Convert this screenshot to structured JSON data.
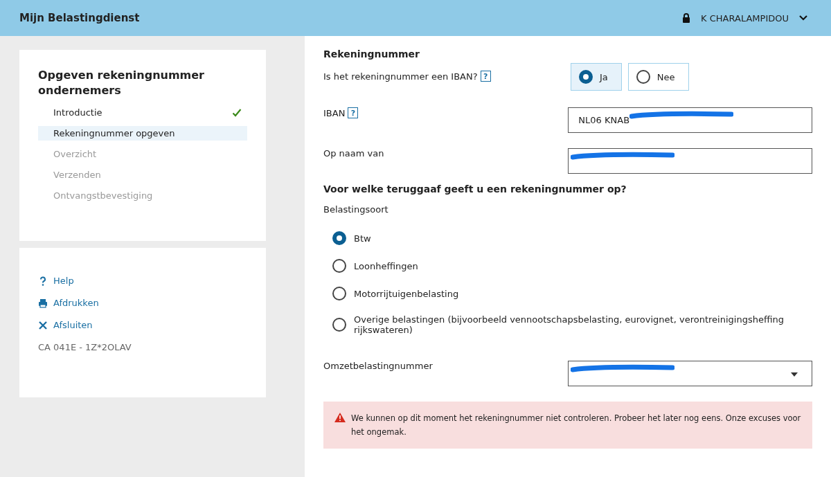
{
  "header": {
    "title": "Mijn Belastingdienst",
    "user": "K CHARALAMPIDOU"
  },
  "sidebar": {
    "title": "Opgeven rekeningnummer ondernemers",
    "steps": [
      {
        "label": "Introductie",
        "selected": false,
        "done": true,
        "disabled": false
      },
      {
        "label": "Rekeningnummer opgeven",
        "selected": true,
        "done": false,
        "disabled": false
      },
      {
        "label": "Overzicht",
        "selected": false,
        "done": false,
        "disabled": true
      },
      {
        "label": "Verzenden",
        "selected": false,
        "done": false,
        "disabled": true
      },
      {
        "label": "Ontvangstbevestiging",
        "selected": false,
        "done": false,
        "disabled": true
      }
    ],
    "links": [
      {
        "kind": "help",
        "label": "Help"
      },
      {
        "kind": "print",
        "label": "Afdrukken"
      },
      {
        "kind": "close",
        "label": "Afsluiten"
      }
    ],
    "code": "CA 041E - 1Z*2OLAV"
  },
  "form": {
    "section_title": "Rekeningnummer",
    "iban_question": {
      "label": "Is het rekeningnummer een IBAN?",
      "help": "?",
      "options": [
        {
          "label": "Ja",
          "selected": true
        },
        {
          "label": "Nee",
          "selected": false
        }
      ]
    },
    "iban": {
      "label": "IBAN",
      "help": "?",
      "value": "NL06 KNAB",
      "redacted": true
    },
    "name": {
      "label": "Op naam van",
      "redacted": true
    },
    "refund_question": "Voor welke teruggaaf geeft u een rekeningnummer op?",
    "tax_type": {
      "label": "Belastingsoort",
      "options": [
        {
          "label": "Btw",
          "selected": true
        },
        {
          "label": "Loonheffingen",
          "selected": false
        },
        {
          "label": "Motorrijtuigenbelasting",
          "selected": false
        },
        {
          "label": "Overige belastingen (bijvoorbeeld vennootschapsbelasting, eurovignet, verontreinigingsheffing rijkswateren)",
          "selected": false
        }
      ]
    },
    "vat_number": {
      "label": "Omzetbelastingnummer",
      "redacted": true
    },
    "error": "We kunnen op dit moment het rekeningnummer niet controleren. Probeer het later nog eens. Onze excuses voor het ongemak."
  }
}
